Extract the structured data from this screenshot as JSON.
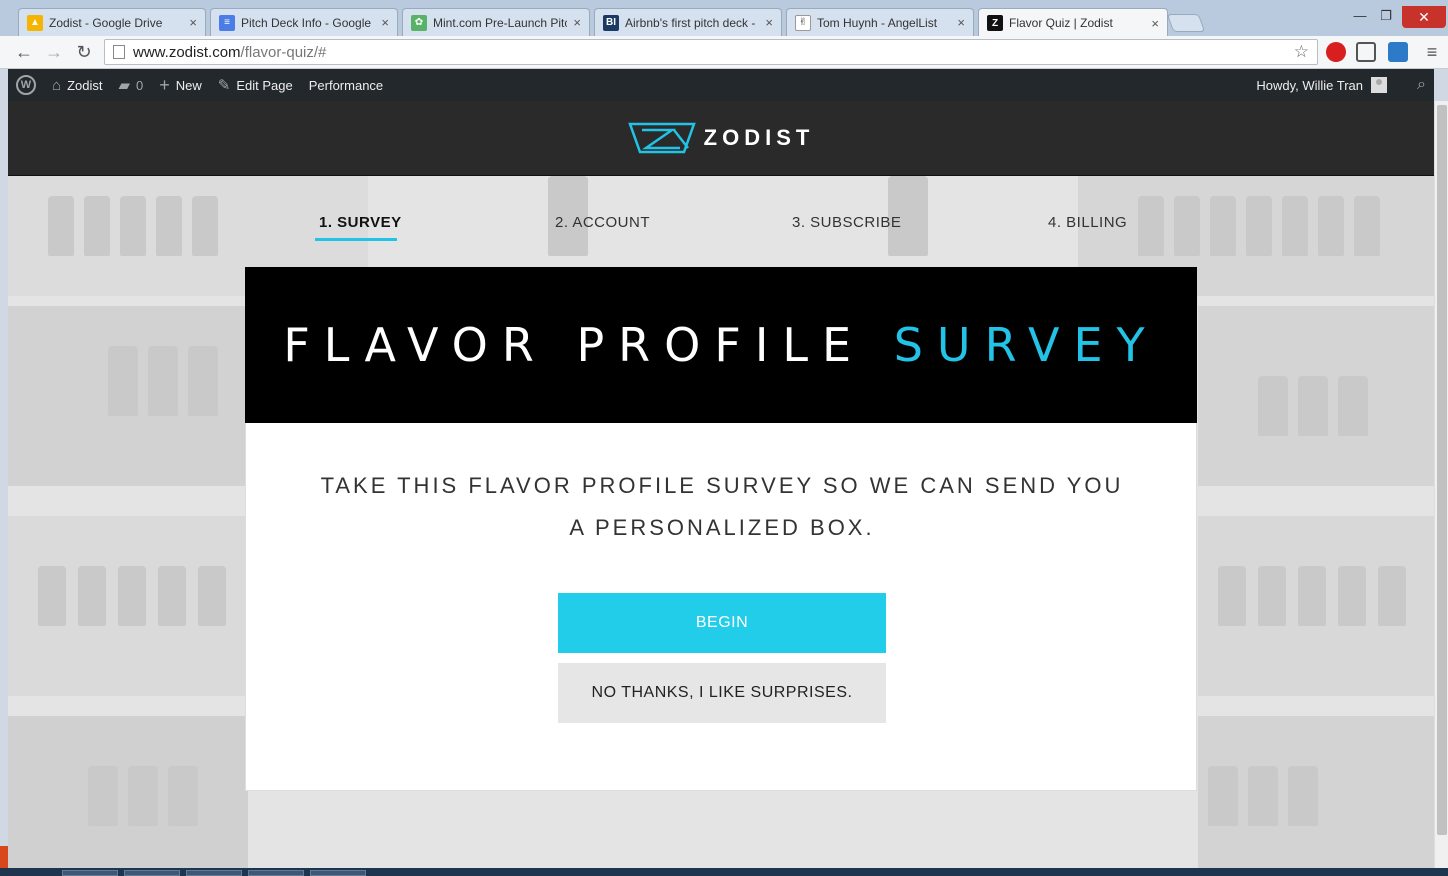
{
  "browser": {
    "tabs": [
      {
        "label": "Zodist - Google Drive",
        "icon": "google-drive-icon",
        "active": false
      },
      {
        "label": "Pitch Deck Info - Google D",
        "icon": "google-docs-icon",
        "active": false
      },
      {
        "label": "Mint.com Pre-Launch Pitc",
        "icon": "mint-icon",
        "active": false
      },
      {
        "label": "Airbnb's first pitch deck -",
        "icon": "business-insider-icon",
        "active": false
      },
      {
        "label": "Tom Huynh - AngelList",
        "icon": "angellist-icon",
        "active": false
      },
      {
        "label": "Flavor Quiz | Zodist",
        "icon": "zodist-icon",
        "active": true
      }
    ],
    "url_host": "www.zodist.com",
    "url_path": "/flavor-quiz/#"
  },
  "adminbar": {
    "site_name": "Zodist",
    "comments_count": "0",
    "new_label": "New",
    "edit_label": "Edit Page",
    "performance_label": "Performance",
    "greeting": "Howdy, Willie Tran"
  },
  "header": {
    "logo_text": "ZODIST"
  },
  "steps": [
    {
      "label": "1. SURVEY",
      "active": true
    },
    {
      "label": "2. ACCOUNT",
      "active": false
    },
    {
      "label": "3. SUBSCRIBE",
      "active": false
    },
    {
      "label": "4. BILLING",
      "active": false
    }
  ],
  "survey": {
    "title_main": "FLAVOR PROFILE",
    "title_accent": "SURVEY",
    "intro_line1": "TAKE THIS FLAVOR PROFILE SURVEY SO WE CAN SEND YOU",
    "intro_line2": "A PERSONALIZED BOX.",
    "begin_label": "BEGIN",
    "skip_label": "NO THANKS, I LIKE SURPRISES."
  },
  "colors": {
    "accent": "#22c3e6",
    "button": "#22cdea",
    "header_bg": "#2a2a2a",
    "adminbar_bg": "#23282d"
  }
}
